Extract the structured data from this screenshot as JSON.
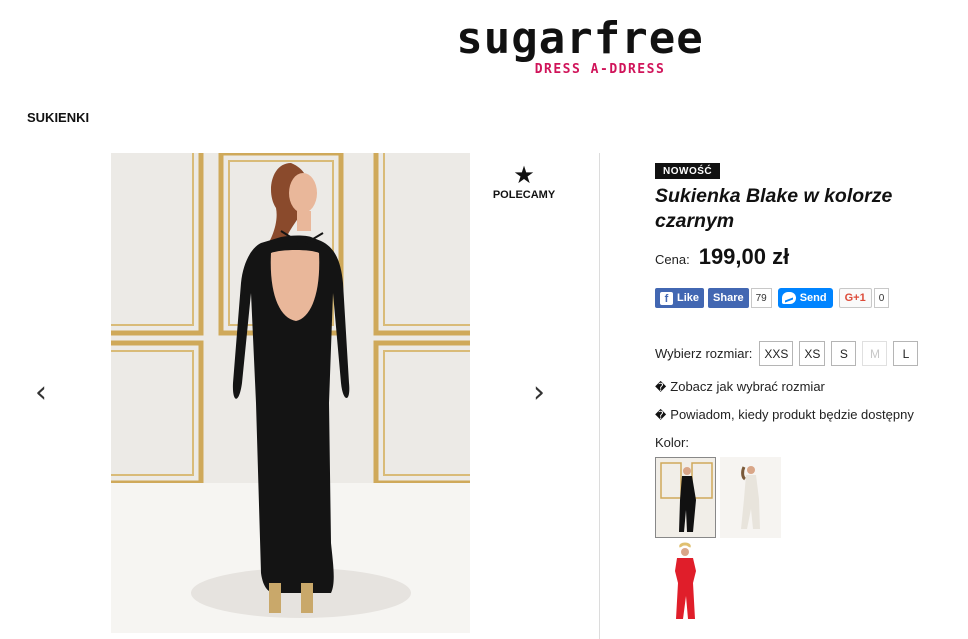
{
  "header": {
    "logo_word": "sugarfree",
    "logo_tagline": "DRESS A-DDRESS"
  },
  "breadcrumb": "SUKIENKI",
  "gallery": {
    "prev_icon": "‹",
    "next_icon": "›",
    "recommended_label": "POLECAMY",
    "recommended_icon": "★"
  },
  "product": {
    "badge": "NOWOŚĆ",
    "title": "Sukienka Blake w kolorze czarnym",
    "price_label": "Cena:",
    "price_value": "199,00 zł"
  },
  "social": {
    "like_label": "Like",
    "share_label": "Share",
    "share_count": "79",
    "send_label": "Send",
    "gplus_label": "G+1",
    "gplus_count": "0"
  },
  "sizes": {
    "label": "Wybierz rozmiar:",
    "options": [
      {
        "label": "XXS",
        "available": true
      },
      {
        "label": "XS",
        "available": true
      },
      {
        "label": "S",
        "available": true
      },
      {
        "label": "M",
        "available": false
      },
      {
        "label": "L",
        "available": true
      }
    ]
  },
  "links": {
    "size_guide": "Zobacz jak wybrać rozmiar",
    "notify": "Powiadom, kiedy produkt będzie dostępny",
    "glyph": "�"
  },
  "colors": {
    "label": "Kolor:",
    "swatches": [
      {
        "name": "czarny",
        "hex": "#111111",
        "selected": true
      },
      {
        "name": "biały",
        "hex": "#e8e4dc",
        "selected": false
      },
      {
        "name": "czerwony",
        "hex": "#e01e2a",
        "selected": false
      }
    ]
  }
}
